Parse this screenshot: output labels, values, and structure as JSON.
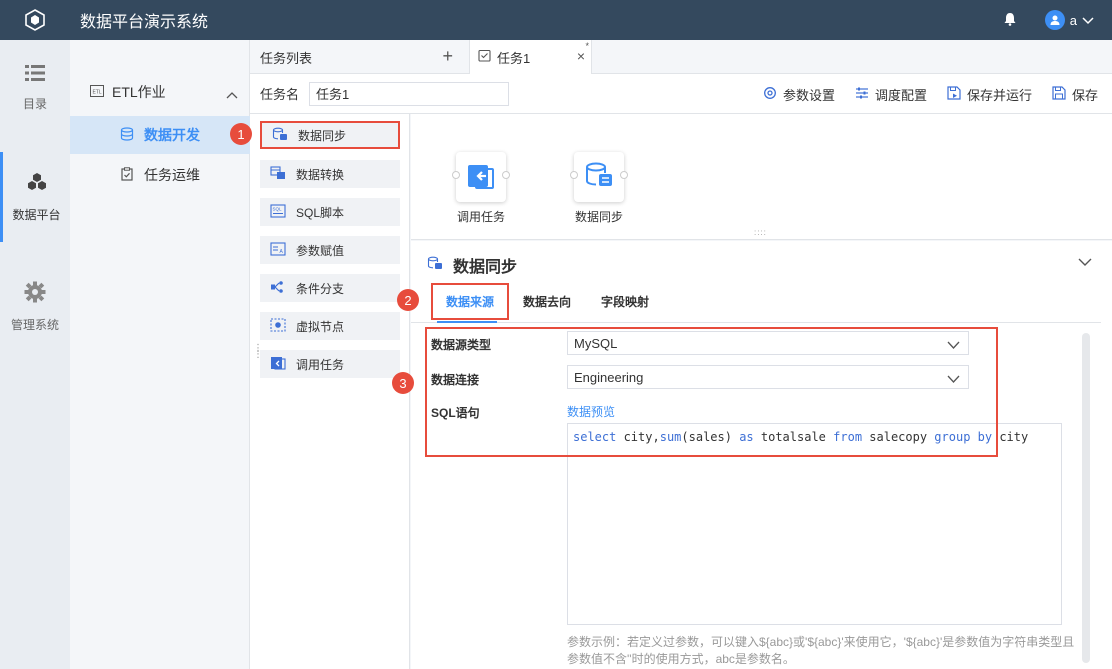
{
  "app": {
    "title": "数据平台演示系统",
    "user": "a"
  },
  "rail": {
    "items": [
      {
        "label": "目录",
        "icon": "list-icon"
      },
      {
        "label": "数据平台",
        "icon": "cubes-icon"
      },
      {
        "label": "管理系统",
        "icon": "gear-icon"
      }
    ]
  },
  "nav": {
    "group": "ETL作业",
    "items": [
      {
        "label": "数据开发",
        "icon": "database-icon",
        "active": true
      },
      {
        "label": "任务运维",
        "icon": "clipboard-check-icon"
      }
    ]
  },
  "tabs": {
    "list_label": "任务列表",
    "add": "+",
    "task_tab": "任务1",
    "close": "×",
    "modified": "*"
  },
  "task": {
    "name_label": "任务名",
    "name_value": "任务1"
  },
  "toolbar": {
    "params": "参数设置",
    "schedule": "调度配置",
    "save_run": "保存并运行",
    "save": "保存"
  },
  "palette": {
    "items": [
      {
        "label": "数据同步",
        "icon": "data-sync-icon"
      },
      {
        "label": "数据转换",
        "icon": "data-transform-icon"
      },
      {
        "label": "SQL脚本",
        "icon": "sql-script-icon"
      },
      {
        "label": "参数赋值",
        "icon": "param-assign-icon"
      },
      {
        "label": "条件分支",
        "icon": "branch-icon"
      },
      {
        "label": "虚拟节点",
        "icon": "virtual-node-icon"
      },
      {
        "label": "调用任务",
        "icon": "call-task-icon"
      }
    ]
  },
  "canvas": {
    "nodes": [
      {
        "label": "调用任务"
      },
      {
        "label": "数据同步"
      }
    ]
  },
  "props": {
    "title": "数据同步",
    "tabs": [
      "数据来源",
      "数据去向",
      "字段映射"
    ],
    "active_tab": 0,
    "source_type_label": "数据源类型",
    "source_type_value": "MySQL",
    "connection_label": "数据连接",
    "connection_value": "Engineering",
    "sql_label": "SQL语句",
    "preview_link": "数据预览",
    "sql": {
      "select": "select",
      "cols": " city,",
      "sum": "sum",
      "args": "(sales) ",
      "as": "as",
      "alias": " totalsale ",
      "from": "from",
      "table": " salecopy ",
      "group_by": "group by",
      "col2": " city"
    },
    "hint": "参数示例：若定义过参数，可以键入${abc}或'${abc}'来使用它，'${abc}'是参数值为字符串类型且参数值不含''时的使用方式，abc是参数名。"
  },
  "badges": [
    "1",
    "2",
    "3"
  ],
  "colors": {
    "topbar": "#34495e",
    "accent": "#3d8ff5",
    "highlight": "#e74c3c"
  }
}
